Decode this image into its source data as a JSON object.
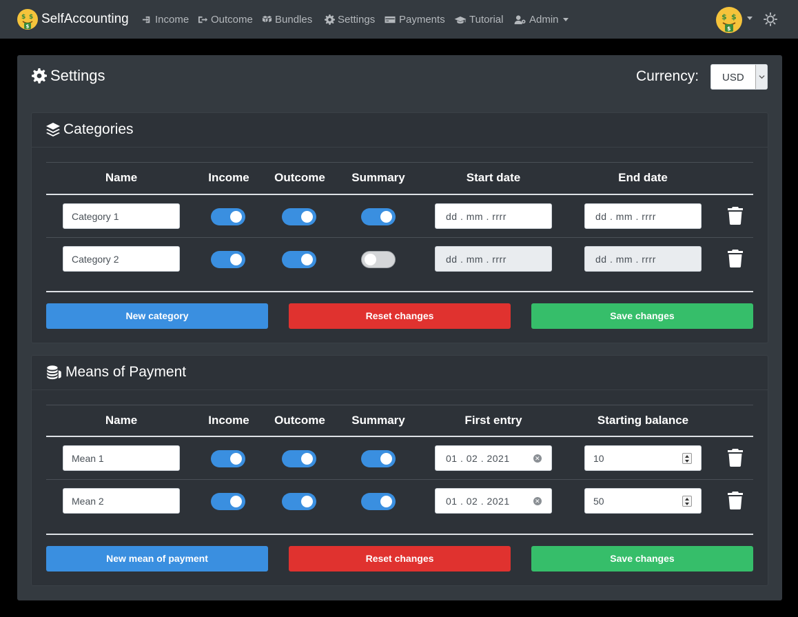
{
  "navbar": {
    "brand": "SelfAccounting",
    "items": [
      {
        "label": "Income",
        "icon": "sign-in-icon"
      },
      {
        "label": "Outcome",
        "icon": "sign-out-icon"
      },
      {
        "label": "Bundles",
        "icon": "boxes-icon"
      },
      {
        "label": "Settings",
        "icon": "gear-icon"
      },
      {
        "label": "Payments",
        "icon": "credit-card-icon"
      },
      {
        "label": "Tutorial",
        "icon": "graduation-cap-icon"
      },
      {
        "label": "Admin",
        "icon": "user-cog-icon"
      }
    ]
  },
  "page": {
    "title": "Settings",
    "currency_label": "Currency:",
    "currency_value": "USD"
  },
  "categories": {
    "title": "Categories",
    "headers": [
      "Name",
      "Income",
      "Outcome",
      "Summary",
      "Start date",
      "End date"
    ],
    "rows": [
      {
        "name": "Category 1",
        "income": true,
        "outcome": true,
        "summary": true,
        "start_date": "dd . mm . rrrr",
        "end_date": "dd . mm . rrrr",
        "dates_disabled": false
      },
      {
        "name": "Category 2",
        "income": true,
        "outcome": true,
        "summary": false,
        "start_date": "dd . mm . rrrr",
        "end_date": "dd . mm . rrrr",
        "dates_disabled": true
      }
    ],
    "buttons": {
      "new": "New category",
      "reset": "Reset changes",
      "save": "Save changes"
    }
  },
  "payments": {
    "title": "Means of Payment",
    "headers": [
      "Name",
      "Income",
      "Outcome",
      "Summary",
      "First entry",
      "Starting balance"
    ],
    "rows": [
      {
        "name": "Mean 1",
        "income": true,
        "outcome": true,
        "summary": true,
        "first_entry": "01 . 02 . 2021",
        "starting_balance": "10"
      },
      {
        "name": "Mean 2",
        "income": true,
        "outcome": true,
        "summary": true,
        "first_entry": "01 . 02 . 2021",
        "starting_balance": "50"
      }
    ],
    "buttons": {
      "new": "New mean of payment",
      "reset": "Reset changes",
      "save": "Save changes"
    }
  },
  "colors": {
    "navbar_bg": "#343a40",
    "card_bg": "#343a40",
    "toggle_on": "#3a8fe0",
    "btn_blue": "#3a8fe0",
    "btn_red": "#e0322f",
    "btn_green": "#36be6a"
  }
}
